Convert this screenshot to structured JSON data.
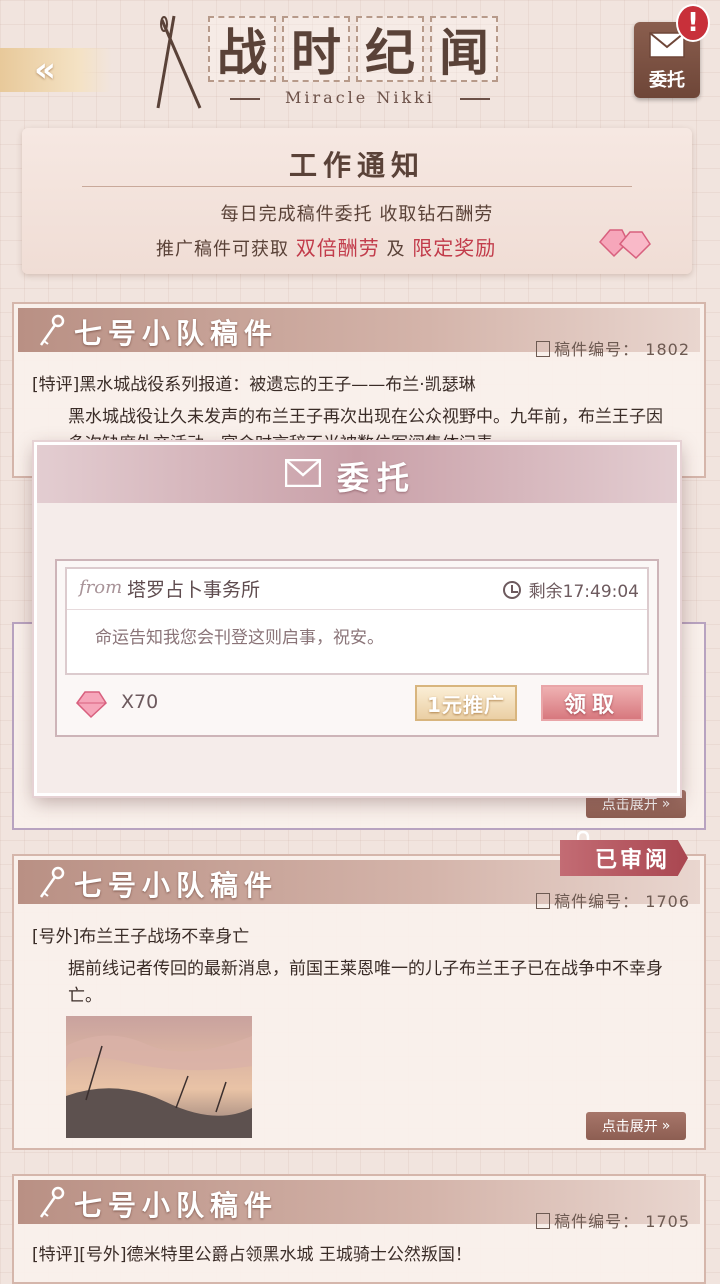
{
  "header": {
    "back_glyph": "«",
    "title_chars": [
      "战",
      "时",
      "纪",
      "闻"
    ],
    "subtitle": "Miracle Nikki",
    "entrust_label": "委托",
    "alert_glyph": "!"
  },
  "notice": {
    "title": "工作通知",
    "line1": "每日完成稿件委托 收取钻石酬劳",
    "line2_prefix": "推广稿件可获取",
    "line2_hl1": "双倍酬劳",
    "line2_mid": "及",
    "line2_hl2": "限定奖励"
  },
  "cards": [
    {
      "team": "七号小队稿件",
      "doc_label": "稿件编号：",
      "doc_number": "1802",
      "headline": "[特评]黑水城战役系列报道：被遗忘的王子——布兰·凯瑟琳",
      "body": "黑水城战役让久未发声的布兰王子再次出现在公众视野中。九年前，布兰王子因多次缺席外交活动，宴会时言辞不当被数位军阀集体问责"
    },
    {
      "team": "七号小队稿件",
      "doc_label": "稿件编号：",
      "doc_number": "1706",
      "headline": "[号外]布兰王子战场不幸身亡",
      "body": "据前线记者传回的最新消息，前国王莱恩唯一的儿子布兰王子已在战争中不幸身亡。",
      "reviewed": "已审阅",
      "expand": "点击展开"
    },
    {
      "team": "七号小队稿件",
      "doc_label": "稿件编号：",
      "doc_number": "1705",
      "headline": "[特评][号外]德米特里公爵占领黑水城 王城骑士公然叛国！"
    }
  ],
  "hidden_card": {
    "expand": "点击展开"
  },
  "modal": {
    "title": "委托",
    "from_word": "from",
    "sender": "塔罗占卜事务所",
    "timer": "剩余17:49:04",
    "message": "命运告知我您会刊登这则启事，祝安。",
    "reward_qty": "X70",
    "promote_label": "1元推广",
    "claim_label": "领取"
  },
  "colors": {
    "accent": "#c23c4b",
    "card_header": "#b99084",
    "modal_header": "#c9a0a8"
  },
  "icons": [
    "back-arrow-icon",
    "needle-icon",
    "envelope-icon",
    "key-icon",
    "diamond-icon",
    "clock-icon",
    "document-icon",
    "paperclip-icon",
    "chevron-down-icon"
  ]
}
